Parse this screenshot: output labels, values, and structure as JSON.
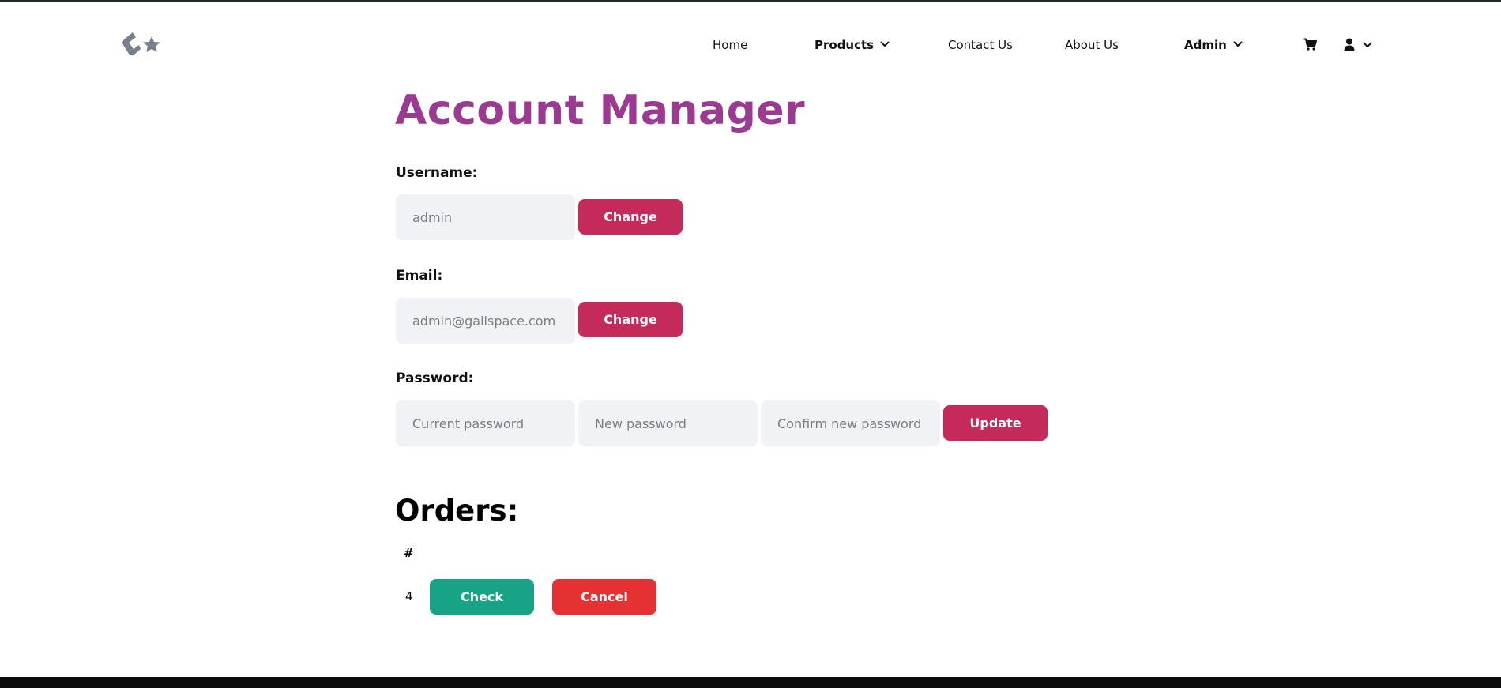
{
  "colors": {
    "title": "#9b3a91",
    "primary_button": "#c42b5b",
    "check_button": "#17a386",
    "cancel_button": "#e53131",
    "input_background": "#f1f2f6",
    "logo": "#7a7f8d"
  },
  "header": {
    "logo_icon": "galispace-logo-icon",
    "nav": {
      "home": "Home",
      "products": "Products",
      "contact": "Contact Us",
      "about": "About Us",
      "admin": "Admin"
    },
    "cart_icon": "cart-icon",
    "user_icon": "user-icon"
  },
  "page": {
    "title": "Account Manager"
  },
  "username": {
    "label": "Username:",
    "placeholder": "admin",
    "button": "Change"
  },
  "email": {
    "label": "Email:",
    "placeholder": "admin@galispace.com",
    "button": "Change"
  },
  "password": {
    "label": "Password:",
    "current_placeholder": "Current password",
    "new_placeholder": "New password",
    "confirm_placeholder": "Confirm new password",
    "button": "Update"
  },
  "orders": {
    "heading": "Orders:",
    "columns": [
      "#"
    ],
    "rows": [
      {
        "id": "4",
        "check_label": "Check",
        "cancel_label": "Cancel"
      }
    ]
  }
}
